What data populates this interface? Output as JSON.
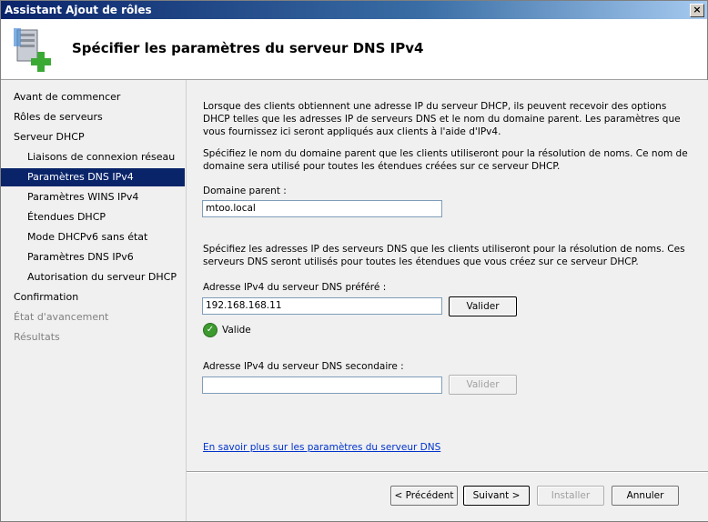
{
  "window": {
    "title": "Assistant Ajout de rôles",
    "close": "×"
  },
  "header": {
    "title": "Spécifier les paramètres du serveur DNS IPv4",
    "icon": "server-add-icon"
  },
  "nav": {
    "items": [
      {
        "label": "Avant de commencer"
      },
      {
        "label": "Rôles de serveurs"
      },
      {
        "label": "Serveur DHCP"
      },
      {
        "label": "Liaisons de connexion réseau"
      },
      {
        "label": "Paramètres DNS IPv4"
      },
      {
        "label": "Paramètres WINS IPv4"
      },
      {
        "label": "Étendues DHCP"
      },
      {
        "label": "Mode DHCPv6 sans état"
      },
      {
        "label": "Paramètres DNS IPv6"
      },
      {
        "label": "Autorisation du serveur DHCP"
      },
      {
        "label": "Confirmation"
      },
      {
        "label": "État d'avancement"
      },
      {
        "label": "Résultats"
      }
    ]
  },
  "content": {
    "intro": "Lorsque des clients obtiennent une adresse IP du serveur DHCP, ils peuvent recevoir des options DHCP telles que les adresses IP de serveurs DNS et le nom du domaine parent. Les paramètres que vous fournissez ici seront appliqués aux clients à l'aide d'IPv4.",
    "domain_desc": "Spécifiez le nom du domaine parent que les clients utiliseront pour la résolution de noms. Ce nom de domaine sera utilisé pour toutes les étendues créées sur ce serveur DHCP.",
    "domain_label": "Domaine parent :",
    "domain_value": "mtoo.local",
    "dns_desc": "Spécifiez les adresses IP des serveurs DNS que les clients utiliseront pour la résolution de noms. Ces serveurs DNS seront utilisés pour toutes les étendues que vous créez sur ce serveur DHCP.",
    "preferred_label": "Adresse IPv4 du serveur DNS préféré :",
    "preferred_value": "192.168.168.11",
    "validate_label": "Valider",
    "valid_text": "Valide",
    "valid_mark": "✓",
    "secondary_label": "Adresse IPv4 du serveur DNS secondaire :",
    "secondary_value": "",
    "validate2_label": "Valider",
    "learn_more": "En savoir plus sur les paramètres du serveur DNS"
  },
  "footer": {
    "previous": "< Précédent",
    "next": "Suivant >",
    "install": "Installer",
    "cancel": "Annuler"
  }
}
